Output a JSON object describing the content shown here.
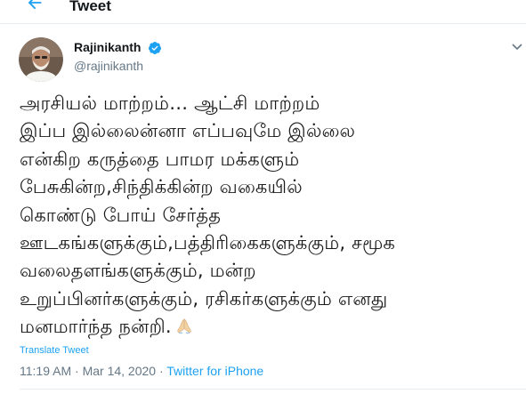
{
  "header": {
    "title": "Tweet",
    "back_icon": "arrow-left-icon",
    "accent": "#1da1f2"
  },
  "author": {
    "name": "Rajinikanth",
    "handle": "@rajinikanth",
    "verified": true,
    "verified_icon": "verified-badge-icon",
    "avatar_icon": "avatar-photo"
  },
  "menu_icon": "chevron-down-icon",
  "tweet": {
    "lines": [
      "அரசியல் மாற்றம்… ஆட்சி மாற்றம்",
      "இப்ப இல்லைன்னா எப்பவுமே இல்லை",
      "என்கிற கருத்தை பாமர மக்களும்",
      "பேசுகின்ற,சிந்திக்கின்ற வகையில்",
      "கொண்டு போய் சேர்த்த",
      "ஊடகங்களுக்கும்,பத்திரிகைகளுக்கும், சமூக",
      "வலைதளங்களுக்கும், மன்ற",
      "உறுப்பினர்களுக்கும், ரசிகர்களுக்கும் எனது",
      "மனமார்ந்த நன்றி."
    ],
    "emoji": "folded-hands-emoji"
  },
  "translate_label": "Translate Tweet",
  "meta": {
    "time": "11:19 AM",
    "separator": "·",
    "date": "Mar 14, 2020",
    "source": "Twitter for iPhone"
  },
  "colors": {
    "text": "#14171a",
    "secondary": "#657786",
    "link": "#1da1f2",
    "divider": "#e6ecf0"
  }
}
